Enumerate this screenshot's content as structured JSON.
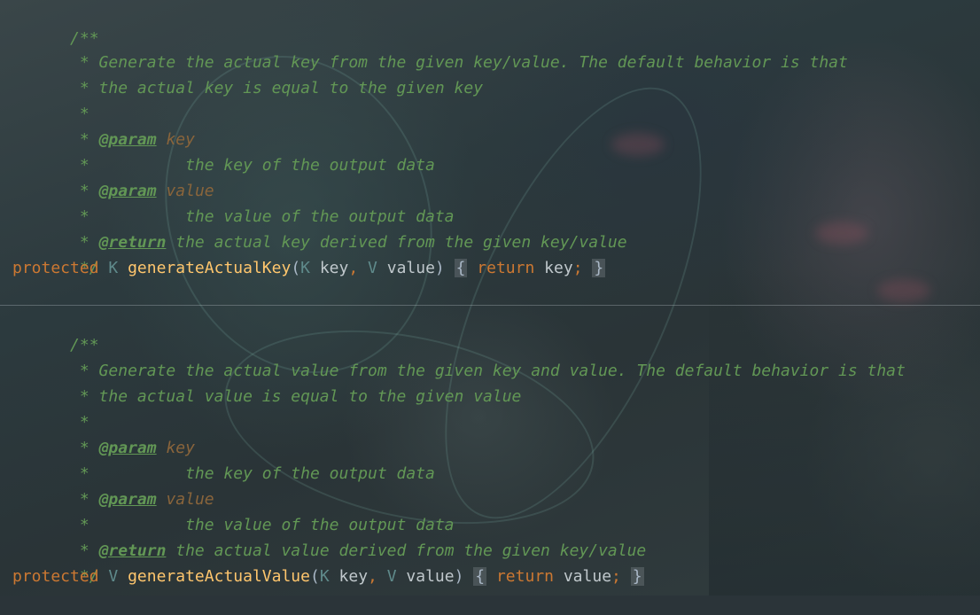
{
  "methods": [
    {
      "doc": {
        "open": "/**",
        "star": " *",
        "desc1": " Generate the actual key from the given key/value. The default behavior is that",
        "desc2": " the actual key is equal to the given key",
        "param_tag": "@param",
        "param1_name": "key",
        "param1_desc": "          the key of the output data",
        "param2_name": "value",
        "param2_desc": "          the value of the output data",
        "return_tag": "@return",
        "return_desc": " the actual key derived from the given key/value",
        "close": " */"
      },
      "signature": {
        "modifier": "protected",
        "return_type": "K",
        "name": "generateActualKey",
        "open_paren": "(",
        "param1_type": "K",
        "param1_name": "key",
        "comma": ",",
        "param2_type": "V",
        "param2_name": "value",
        "close_paren": ")",
        "open_brace": "{",
        "return_keyword": "return",
        "return_value": "key",
        "semicolon": ";",
        "close_brace": "}"
      }
    },
    {
      "doc": {
        "open": "/**",
        "star": " *",
        "desc1": " Generate the actual value from the given key and value. The default behavior is that",
        "desc2": " the actual value is equal to the given value",
        "param_tag": "@param",
        "param1_name": "key",
        "param1_desc": "          the key of the output data",
        "param2_name": "value",
        "param2_desc": "          the value of the output data",
        "return_tag": "@return",
        "return_desc": " the actual value derived from the given key/value",
        "close": " */"
      },
      "signature": {
        "modifier": "protected",
        "return_type": "V",
        "name": "generateActualValue",
        "open_paren": "(",
        "param1_type": "K",
        "param1_name": "key",
        "comma": ",",
        "param2_type": "V",
        "param2_name": "value",
        "close_paren": ")",
        "open_brace": "{",
        "return_keyword": "return",
        "return_value": "value",
        "semicolon": ";",
        "close_brace": "}"
      }
    }
  ],
  "colors": {
    "comment": "#629755",
    "keyword": "#cc7832",
    "function": "#ffc66d",
    "type": "#5f8a8b",
    "param_name": "#8a653b",
    "identifier": "#c0c8cc"
  }
}
